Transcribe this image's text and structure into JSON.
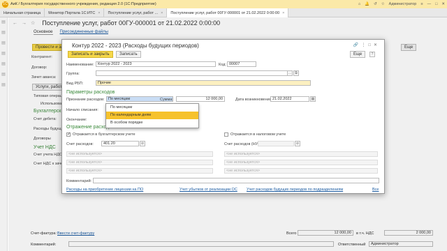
{
  "app": {
    "title": "АиК / Бухгалтерия государственного учреждения, редакция 2.0  (1С:Предприятие)",
    "user": "Администратор",
    "controls": [
      "⌂",
      "🔔",
      "↺",
      "☆",
      "≡",
      "—",
      "□",
      "✕"
    ]
  },
  "tabs": [
    {
      "label": "Начальная страница"
    },
    {
      "label": "Монитор Портала 1С:ИТС"
    },
    {
      "label": "Поступление услуг, работ ..."
    },
    {
      "label": "Поступление услуг, работ 00ГУ-000001 от 21.02.2022 0:00:00"
    }
  ],
  "doc": {
    "title": "Поступление услуг, работ 00ГУ-000001 от 21.02.2022 0:00:00",
    "subtabs": [
      "Основное",
      "Присоединенные файлы"
    ],
    "post_close": "Провести и за",
    "more": "Еще",
    "labels": {
      "contractor": "Контрагент:",
      "contract": "Договор:",
      "advance": "Зачет аванса:",
      "tab_services": "Услуги, работы",
      "typical_op": "Типовая операц",
      "use": "Использован",
      "acc_section": "Бухгалтерск",
      "debit": "Счет дебета:",
      "expense_acc": "Расходы будущ",
      "contracts": "Договоры",
      "vat_section": "Учет НДС",
      "vat_acc": "Счет учета НДС",
      "vat_ref": "Счет НДС к зачету"
    },
    "bottom": {
      "invoice_label": "Счет-фактура:",
      "invoice_link": "Ввести счет-фактуру",
      "total_label": "Всего",
      "total": "12 000,00",
      "vat_label": "в т.ч. НДС",
      "vat": "2 000,00",
      "comment_label": "Комментарий:",
      "resp_label": "Ответственный",
      "resp": "Администратор"
    }
  },
  "dialog": {
    "title": "Контур 2022 - 2023 (Расходы будущих периодов)",
    "btn_save_close": "Записать и закрыть",
    "btn_save": "Записать",
    "more": "Еще",
    "name_label": "Наименование:",
    "name_value": "Контур 2022 - 2023",
    "code_label": "Код:",
    "code_value": "00007",
    "group_label": "Группа:",
    "vid_label": "Вид РБП:",
    "vid_value": "Прочие",
    "params_section": "Параметры расходов",
    "recognition_label": "Признание расходов:",
    "recognition_value": "По месяцам",
    "sum_label": "Сумма:",
    "sum_value": "12 000,00",
    "date_label": "Дата возникновения:",
    "date_value": "21.02.2022",
    "start_label": "Начало списания:",
    "end_label": "Окончание:",
    "reflect_section": "Отражение расходов",
    "reflect_acc": "Отражается в бухгалтерском учете",
    "reflect_tax": "Отражается в налоговом учете",
    "expense_acc_label": "Счет расходов:",
    "expense_acc_value": "401.20",
    "expense_tax_label": "Счет расходов (НУ):",
    "unused": "<не используется>",
    "comment_label": "Комментарий:",
    "links": [
      "Расходы на приобретение лицензии на ПО",
      "Учет убытков от реализации ОС",
      "Учет расходов будущих периодов по подразделениям"
    ],
    "all_link": "Все",
    "options": [
      "По месяцам",
      "По календарным дням",
      "В особом порядке"
    ]
  }
}
